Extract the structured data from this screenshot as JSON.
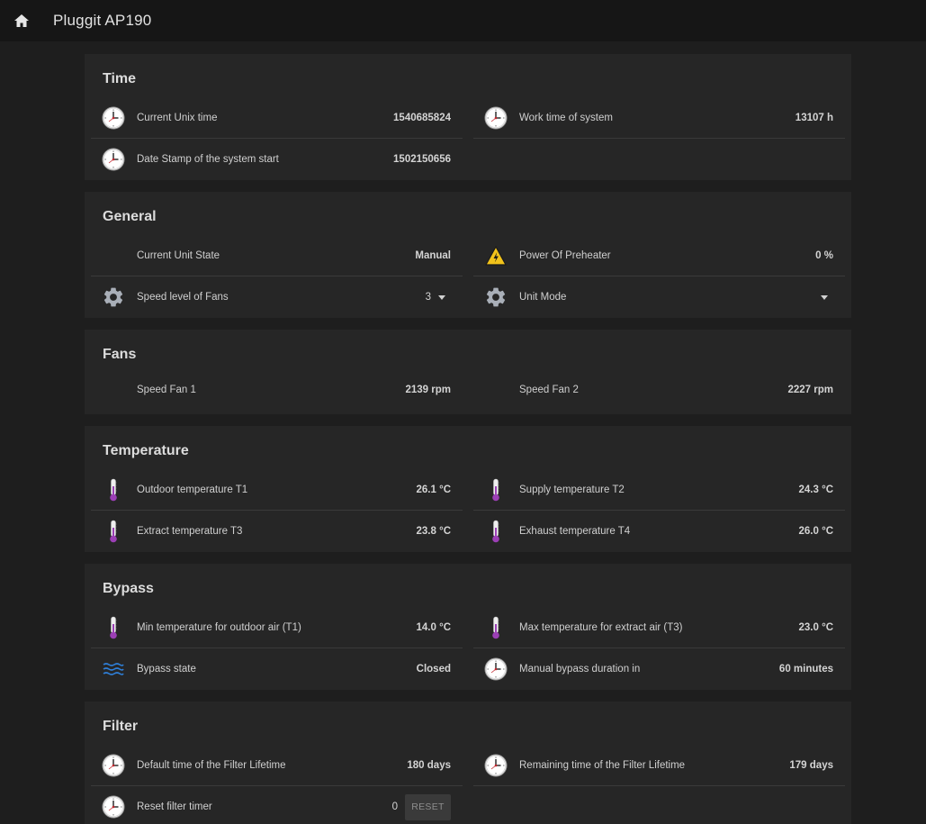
{
  "app": {
    "title": "Pluggit AP190"
  },
  "icons": {
    "home": "home-icon",
    "clock": "clock-icon",
    "thermometer": "thermometer-icon",
    "warning": "warning-icon",
    "gear": "gear-icon",
    "waves": "waves-icon"
  },
  "colors": {
    "accent_purple": "#9b3fb5",
    "warning_yellow": "#f2c31b",
    "bypass_blue": "#2f7fd8"
  },
  "time": {
    "title": "Time",
    "current_unix_label": "Current Unix time",
    "current_unix_value": "1540685824",
    "work_time_label": "Work time of system",
    "work_time_value": "13107 h",
    "date_stamp_label": "Date Stamp of the system start",
    "date_stamp_value": "1502150656"
  },
  "general": {
    "title": "General",
    "unit_state_label": "Current Unit State",
    "unit_state_value": "Manual",
    "preheater_label": "Power Of Preheater",
    "preheater_value": "0 %",
    "fan_speed_label": "Speed level of Fans",
    "fan_speed_value": "3",
    "unit_mode_label": "Unit Mode",
    "unit_mode_value": ""
  },
  "fans": {
    "title": "Fans",
    "fan1_label": "Speed Fan 1",
    "fan1_value": "2139 rpm",
    "fan2_label": "Speed Fan 2",
    "fan2_value": "2227 rpm"
  },
  "temperature": {
    "title": "Temperature",
    "t1_label": "Outdoor temperature T1",
    "t1_value": "26.1 °C",
    "t2_label": "Supply temperature T2",
    "t2_value": "24.3 °C",
    "t3_label": "Extract temperature T3",
    "t3_value": "23.8 °C",
    "t4_label": "Exhaust temperature T4",
    "t4_value": "26.0 °C"
  },
  "bypass": {
    "title": "Bypass",
    "min_label": "Min temperature for outdoor air (T1)",
    "min_value": "14.0 °C",
    "max_label": "Max temperature for extract air (T3)",
    "max_value": "23.0 °C",
    "state_label": "Bypass state",
    "state_value": "Closed",
    "duration_label": "Manual bypass duration in",
    "duration_value": "60 minutes"
  },
  "filter": {
    "title": "Filter",
    "default_label": "Default time of the Filter Lifetime",
    "default_value": "180 days",
    "remaining_label": "Remaining time of the Filter Lifetime",
    "remaining_value": "179 days",
    "reset_label": "Reset filter timer",
    "reset_value": "0",
    "reset_button": "RESET"
  }
}
